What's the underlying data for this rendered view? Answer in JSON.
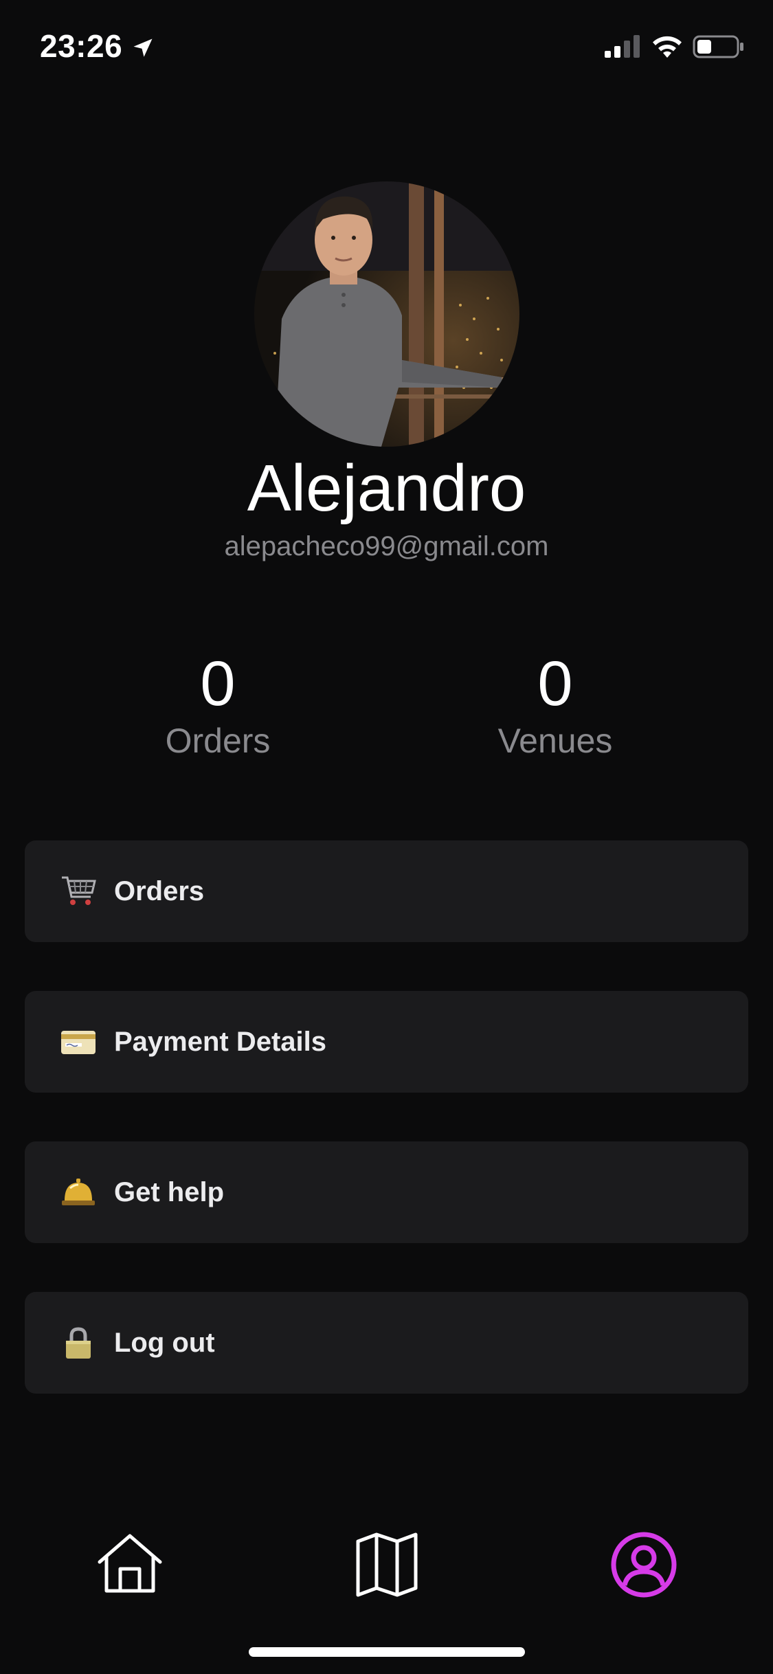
{
  "status_bar": {
    "time": "23:26",
    "location_icon": "location-arrow-icon",
    "signal_icon": "cellular-signal-icon",
    "wifi_icon": "wifi-icon",
    "battery_icon": "battery-icon",
    "battery_level": 0.35
  },
  "profile": {
    "avatar_icon": "profile-photo",
    "name": "Alejandro",
    "email": "alepacheco99@gmail.com"
  },
  "stats": {
    "orders": {
      "value": "0",
      "label": "Orders"
    },
    "venues": {
      "value": "0",
      "label": "Venues"
    }
  },
  "menu": {
    "items": [
      {
        "label": "Orders",
        "icon": "shopping-cart-icon"
      },
      {
        "label": "Payment Details",
        "icon": "credit-card-icon"
      },
      {
        "label": "Get help",
        "icon": "service-bell-icon"
      },
      {
        "label": "Log out",
        "icon": "lock-icon"
      }
    ]
  },
  "tab_bar": {
    "tabs": [
      {
        "icon": "home-icon",
        "active": false
      },
      {
        "icon": "map-icon",
        "active": false
      },
      {
        "icon": "user-profile-icon",
        "active": true
      }
    ],
    "active_color": "#d63be8",
    "inactive_color": "#ffffff"
  },
  "colors": {
    "background": "#0b0b0c",
    "card": "#1b1b1d",
    "secondary_text": "#8a8a8e"
  }
}
